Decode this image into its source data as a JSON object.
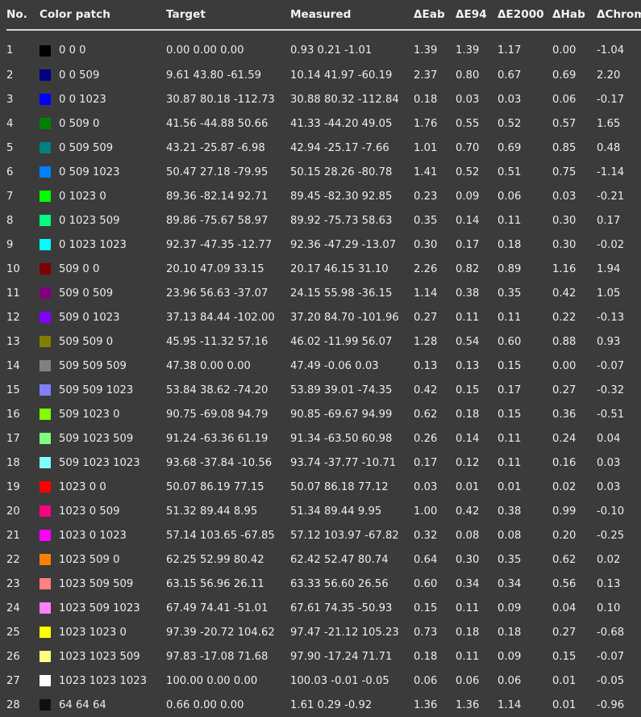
{
  "headers": {
    "no": "No.",
    "patch": "Color patch",
    "target": "Target",
    "measured": "Measured",
    "eab": "ΔEab",
    "e94": "ΔE94",
    "e2000": "ΔE2000",
    "hab": "ΔHab",
    "chroma": "ΔChroma"
  },
  "rows": [
    {
      "no": "1",
      "patch": "0 0 0",
      "color": "#000000",
      "target": "0.00 0.00 0.00",
      "measured": "0.93 0.21 -1.01",
      "eab": "1.39",
      "e94": "1.39",
      "e2000": "1.17",
      "hab": "0.00",
      "chroma": "-1.04"
    },
    {
      "no": "2",
      "patch": "0 0 509",
      "color": "#000080",
      "target": "9.61 43.80 -61.59",
      "measured": "10.14 41.97 -60.19",
      "eab": "2.37",
      "e94": "0.80",
      "e2000": "0.67",
      "hab": "0.69",
      "chroma": "2.20"
    },
    {
      "no": "3",
      "patch": "0 0 1023",
      "color": "#0000ff",
      "target": "30.87 80.18 -112.73",
      "measured": "30.88 80.32 -112.84",
      "eab": "0.18",
      "e94": "0.03",
      "e2000": "0.03",
      "hab": "0.06",
      "chroma": "-0.17"
    },
    {
      "no": "4",
      "patch": "0 509 0",
      "color": "#008000",
      "target": "41.56 -44.88 50.66",
      "measured": "41.33 -44.20 49.05",
      "eab": "1.76",
      "e94": "0.55",
      "e2000": "0.52",
      "hab": "0.57",
      "chroma": "1.65"
    },
    {
      "no": "5",
      "patch": "0 509 509",
      "color": "#008080",
      "target": "43.21 -25.87 -6.98",
      "measured": "42.94 -25.17 -7.66",
      "eab": "1.01",
      "e94": "0.70",
      "e2000": "0.69",
      "hab": "0.85",
      "chroma": "0.48"
    },
    {
      "no": "6",
      "patch": "0 509 1023",
      "color": "#0080ff",
      "target": "50.47 27.18 -79.95",
      "measured": "50.15 28.26 -80.78",
      "eab": "1.41",
      "e94": "0.52",
      "e2000": "0.51",
      "hab": "0.75",
      "chroma": "-1.14"
    },
    {
      "no": "7",
      "patch": "0 1023 0",
      "color": "#00ff00",
      "target": "89.36 -82.14 92.71",
      "measured": "89.45 -82.30 92.85",
      "eab": "0.23",
      "e94": "0.09",
      "e2000": "0.06",
      "hab": "0.03",
      "chroma": "-0.21"
    },
    {
      "no": "8",
      "patch": "0 1023 509",
      "color": "#00ff80",
      "target": "89.86 -75.67 58.97",
      "measured": "89.92 -75.73 58.63",
      "eab": "0.35",
      "e94": "0.14",
      "e2000": "0.11",
      "hab": "0.30",
      "chroma": "0.17"
    },
    {
      "no": "9",
      "patch": "0 1023 1023",
      "color": "#00ffff",
      "target": "92.37 -47.35 -12.77",
      "measured": "92.36 -47.29 -13.07",
      "eab": "0.30",
      "e94": "0.17",
      "e2000": "0.18",
      "hab": "0.30",
      "chroma": "-0.02"
    },
    {
      "no": "10",
      "patch": "509 0 0",
      "color": "#800000",
      "target": "20.10 47.09 33.15",
      "measured": "20.17 46.15 31.10",
      "eab": "2.26",
      "e94": "0.82",
      "e2000": "0.89",
      "hab": "1.16",
      "chroma": "1.94"
    },
    {
      "no": "11",
      "patch": "509 0 509",
      "color": "#800080",
      "target": "23.96 56.63 -37.07",
      "measured": "24.15 55.98 -36.15",
      "eab": "1.14",
      "e94": "0.38",
      "e2000": "0.35",
      "hab": "0.42",
      "chroma": "1.05"
    },
    {
      "no": "12",
      "patch": "509 0 1023",
      "color": "#8000ff",
      "target": "37.13 84.44 -102.00",
      "measured": "37.20 84.70 -101.96",
      "eab": "0.27",
      "e94": "0.11",
      "e2000": "0.11",
      "hab": "0.22",
      "chroma": "-0.13"
    },
    {
      "no": "13",
      "patch": "509 509 0",
      "color": "#808000",
      "target": "45.95 -11.32 57.16",
      "measured": "46.02 -11.99 56.07",
      "eab": "1.28",
      "e94": "0.54",
      "e2000": "0.60",
      "hab": "0.88",
      "chroma": "0.93"
    },
    {
      "no": "14",
      "patch": "509 509 509",
      "color": "#808080",
      "target": "47.38 0.00 0.00",
      "measured": "47.49 -0.06 0.03",
      "eab": "0.13",
      "e94": "0.13",
      "e2000": "0.15",
      "hab": "0.00",
      "chroma": "-0.07"
    },
    {
      "no": "15",
      "patch": "509 509 1023",
      "color": "#8080ff",
      "target": "53.84 38.62 -74.20",
      "measured": "53.89 39.01 -74.35",
      "eab": "0.42",
      "e94": "0.15",
      "e2000": "0.17",
      "hab": "0.27",
      "chroma": "-0.32"
    },
    {
      "no": "16",
      "patch": "509 1023 0",
      "color": "#80ff00",
      "target": "90.75 -69.08 94.79",
      "measured": "90.85 -69.67 94.99",
      "eab": "0.62",
      "e94": "0.18",
      "e2000": "0.15",
      "hab": "0.36",
      "chroma": "-0.51"
    },
    {
      "no": "17",
      "patch": "509 1023 509",
      "color": "#80ff80",
      "target": "91.24 -63.36 61.19",
      "measured": "91.34 -63.50 60.98",
      "eab": "0.26",
      "e94": "0.14",
      "e2000": "0.11",
      "hab": "0.24",
      "chroma": "0.04"
    },
    {
      "no": "18",
      "patch": "509 1023 1023",
      "color": "#80ffff",
      "target": "93.68 -37.84 -10.56",
      "measured": "93.74 -37.77 -10.71",
      "eab": "0.17",
      "e94": "0.12",
      "e2000": "0.11",
      "hab": "0.16",
      "chroma": "0.03"
    },
    {
      "no": "19",
      "patch": "1023 0 0",
      "color": "#ff0000",
      "target": "50.07 86.19 77.15",
      "measured": "50.07 86.18 77.12",
      "eab": "0.03",
      "e94": "0.01",
      "e2000": "0.01",
      "hab": "0.02",
      "chroma": "0.03"
    },
    {
      "no": "20",
      "patch": "1023 0 509",
      "color": "#ff0080",
      "target": "51.32 89.44 8.95",
      "measured": "51.34 89.44 9.95",
      "eab": "1.00",
      "e94": "0.42",
      "e2000": "0.38",
      "hab": "0.99",
      "chroma": "-0.10"
    },
    {
      "no": "21",
      "patch": "1023 0 1023",
      "color": "#ff00ff",
      "target": "57.14 103.65 -67.85",
      "measured": "57.12 103.97 -67.82",
      "eab": "0.32",
      "e94": "0.08",
      "e2000": "0.08",
      "hab": "0.20",
      "chroma": "-0.25"
    },
    {
      "no": "22",
      "patch": "1023 509 0",
      "color": "#ff8000",
      "target": "62.25 52.99 80.42",
      "measured": "62.42 52.47 80.74",
      "eab": "0.64",
      "e94": "0.30",
      "e2000": "0.35",
      "hab": "0.62",
      "chroma": "0.02"
    },
    {
      "no": "23",
      "patch": "1023 509 509",
      "color": "#ff8080",
      "target": "63.15 56.96 26.11",
      "measured": "63.33 56.60 26.56",
      "eab": "0.60",
      "e94": "0.34",
      "e2000": "0.34",
      "hab": "0.56",
      "chroma": "0.13"
    },
    {
      "no": "24",
      "patch": "1023 509 1023",
      "color": "#ff80ff",
      "target": "67.49 74.41 -51.01",
      "measured": "67.61 74.35 -50.93",
      "eab": "0.15",
      "e94": "0.11",
      "e2000": "0.09",
      "hab": "0.04",
      "chroma": "0.10"
    },
    {
      "no": "25",
      "patch": "1023 1023 0",
      "color": "#ffff00",
      "target": "97.39 -20.72 104.62",
      "measured": "97.47 -21.12 105.23",
      "eab": "0.73",
      "e94": "0.18",
      "e2000": "0.18",
      "hab": "0.27",
      "chroma": "-0.68"
    },
    {
      "no": "26",
      "patch": "1023 1023 509",
      "color": "#ffff80",
      "target": "97.83 -17.08 71.68",
      "measured": "97.90 -17.24 71.71",
      "eab": "0.18",
      "e94": "0.11",
      "e2000": "0.09",
      "hab": "0.15",
      "chroma": "-0.07"
    },
    {
      "no": "27",
      "patch": "1023 1023 1023",
      "color": "#ffffff",
      "target": "100.00 0.00 0.00",
      "measured": "100.03 -0.01 -0.05",
      "eab": "0.06",
      "e94": "0.06",
      "e2000": "0.06",
      "hab": "0.01",
      "chroma": "-0.05"
    },
    {
      "no": "28",
      "patch": "64 64 64",
      "color": "#101010",
      "target": "0.66 0.00 0.00",
      "measured": "1.61 0.29 -0.92",
      "eab": "1.36",
      "e94": "1.36",
      "e2000": "1.14",
      "hab": "0.01",
      "chroma": "-0.96"
    }
  ]
}
